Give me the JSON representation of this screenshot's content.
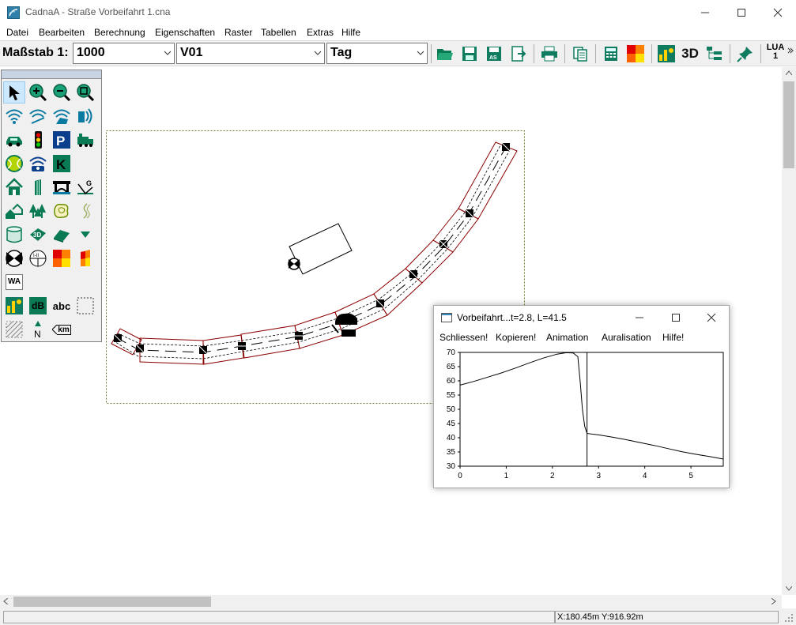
{
  "window": {
    "title": "CadnaA - Straße Vorbeifahrt 1.cna"
  },
  "menu": [
    "Datei",
    "Bearbeiten",
    "Berechnung",
    "Eigenschaften",
    "Raster",
    "Tabellen",
    "Extras",
    "Hilfe"
  ],
  "toolbar": {
    "scale_label": "Maßstab 1:",
    "scale_value": "1000",
    "variant_value": "V01",
    "period_value": "Tag",
    "btn_3d": "3D",
    "lua_label": "LUA",
    "lua_value": "1"
  },
  "palette": {
    "wa_label": "WA",
    "db_label": "dB",
    "abc_label": "abc",
    "km_label": "km"
  },
  "status": {
    "coords": "X:180.45m Y:916.92m"
  },
  "popup": {
    "title": "Vorbeifahrt...t=2.8, L=41.5",
    "menu": [
      "Schliessen!",
      "Kopieren!",
      "Animation",
      "Auralisation",
      "Hilfe!"
    ]
  },
  "chart_data": {
    "type": "line",
    "title": "",
    "xlabel": "",
    "ylabel": "",
    "xlim": [
      0,
      5.7
    ],
    "ylim": [
      30,
      70
    ],
    "xticks": [
      0,
      1,
      2,
      3,
      4,
      5
    ],
    "yticks": [
      30,
      35,
      40,
      45,
      50,
      55,
      60,
      65,
      70
    ],
    "series": [
      {
        "x": [
          0,
          0.3,
          0.6,
          0.9,
          1.2,
          1.5,
          1.8,
          2.1,
          2.3,
          2.45,
          2.55,
          2.6,
          2.65,
          2.7,
          2.75,
          3.0,
          3.3,
          3.6,
          3.9,
          4.2,
          4.5,
          4.8,
          5.1,
          5.4,
          5.7
        ],
        "y": [
          58.5,
          59.8,
          61.3,
          62.8,
          64.5,
          66.3,
          68.0,
          69.4,
          69.9,
          69.8,
          68.5,
          60.0,
          50.0,
          44.0,
          41.5,
          41.0,
          40.2,
          39.3,
          38.3,
          37.3,
          36.2,
          35.1,
          34.2,
          33.4,
          32.5
        ]
      }
    ],
    "markers": [
      {
        "x": 2.75,
        "label": ""
      }
    ],
    "grid": false,
    "legend": "none"
  }
}
